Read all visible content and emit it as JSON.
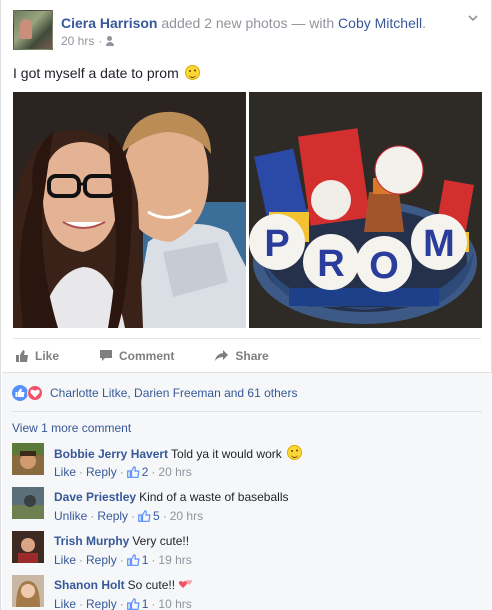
{
  "post": {
    "author": "Ciera Harrison",
    "action": " added 2 new photos — with ",
    "tagged": "Coby Mitchell",
    "tagged_suffix": ".",
    "time": "20 hrs",
    "audience_icon": "friends-icon",
    "text": "I got myself a date to prom"
  },
  "actions": {
    "like": "Like",
    "comment": "Comment",
    "share": "Share"
  },
  "reactions": {
    "summary": "Charlotte Litke, Darien Freeman and 61 others",
    "icons": [
      "like-icon",
      "love-icon"
    ]
  },
  "comments_section": {
    "view_more": "View 1 more comment",
    "comments": [
      {
        "name": "Bobbie Jerry Havert",
        "text": "Told ya it would work",
        "emoji": "wink-emoji",
        "like_label": "Like",
        "reply_label": "Reply",
        "likes": "2",
        "time": "20 hrs"
      },
      {
        "name": "Dave Priestley",
        "text": "Kind of a waste of baseballs",
        "like_label": "Unlike",
        "reply_label": "Reply",
        "likes": "5",
        "time": "20 hrs"
      },
      {
        "name": "Trish Murphy",
        "text": "Very cute!!",
        "like_label": "Like",
        "reply_label": "Reply",
        "likes": "1",
        "time": "19 hrs"
      },
      {
        "name": "Shanon Holt",
        "text": "So cute!!",
        "emoji": "two-hearts-emoji",
        "like_label": "Like",
        "reply_label": "Reply",
        "likes": "1",
        "time": "10 hrs"
      }
    ]
  },
  "colors": {
    "link": "#365899",
    "meta": "#90949c",
    "like_blue": "#5890ff",
    "love_red": "#f25268"
  }
}
